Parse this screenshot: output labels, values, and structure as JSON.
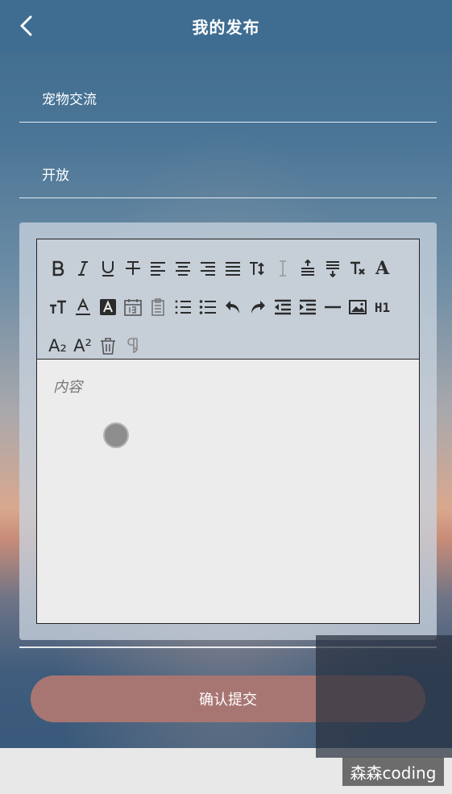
{
  "navbar": {
    "title": "我的发布",
    "back_icon": "chevron-left-icon"
  },
  "form": {
    "type_value": "宠物交流",
    "status_value": "开放",
    "content_placeholder": "内容"
  },
  "toolbar": {
    "heading_label": "H1",
    "serif_a_label": "A",
    "subscript_label": "A₂",
    "superscript_label": "A²"
  },
  "submit": {
    "label": "确认提交"
  },
  "watermark": {
    "text": "森森coding"
  },
  "colors": {
    "navbar": "#3f6d92",
    "submit_button": "#a87672",
    "editor_bg": "#ececec"
  }
}
